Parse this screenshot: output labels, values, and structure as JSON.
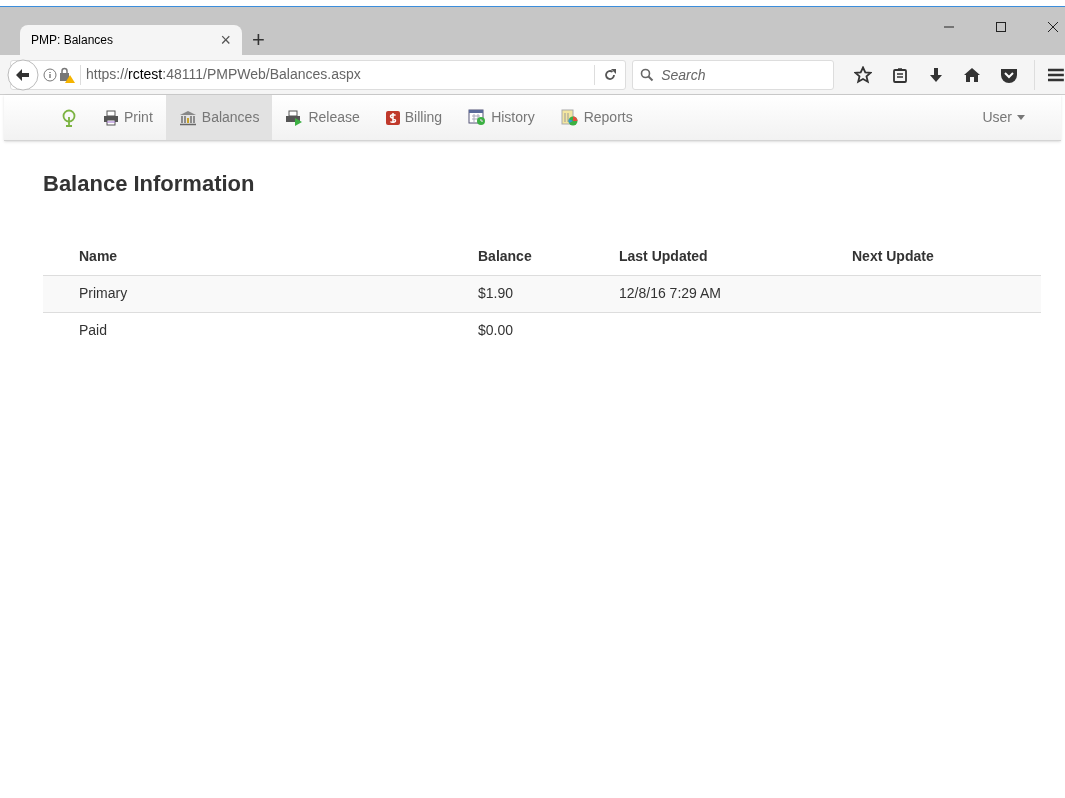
{
  "browser": {
    "tab": {
      "title": "PMP: Balances",
      "close": "×"
    },
    "new_tab": "+",
    "url": "https://**rctest**:48111/PMPWeb/Balances.aspx",
    "search": {
      "placeholder": "Search"
    }
  },
  "nav": {
    "items": [
      {
        "kind": "home",
        "selected": false
      },
      {
        "kind": "print",
        "label": "Print",
        "selected": false
      },
      {
        "kind": "balances",
        "label": "Balances",
        "selected": true
      },
      {
        "kind": "release",
        "label": "Release",
        "selected": false
      },
      {
        "kind": "billing",
        "label": "Billing",
        "selected": false
      },
      {
        "kind": "history",
        "label": "History",
        "selected": false
      },
      {
        "kind": "reports",
        "label": "Reports",
        "selected": false
      }
    ],
    "user": "User"
  },
  "heading": "Balance Information",
  "table": {
    "columns": [
      "Name",
      "Balance",
      "Last Updated",
      "Next Update"
    ],
    "rows": [
      {
        "name": "Primary",
        "balance": "$1.90",
        "last_updated": "12/8/16 7:29 AM"
      },
      {
        "name": "Paid",
        "balance": "$0.00"
      }
    ]
  }
}
